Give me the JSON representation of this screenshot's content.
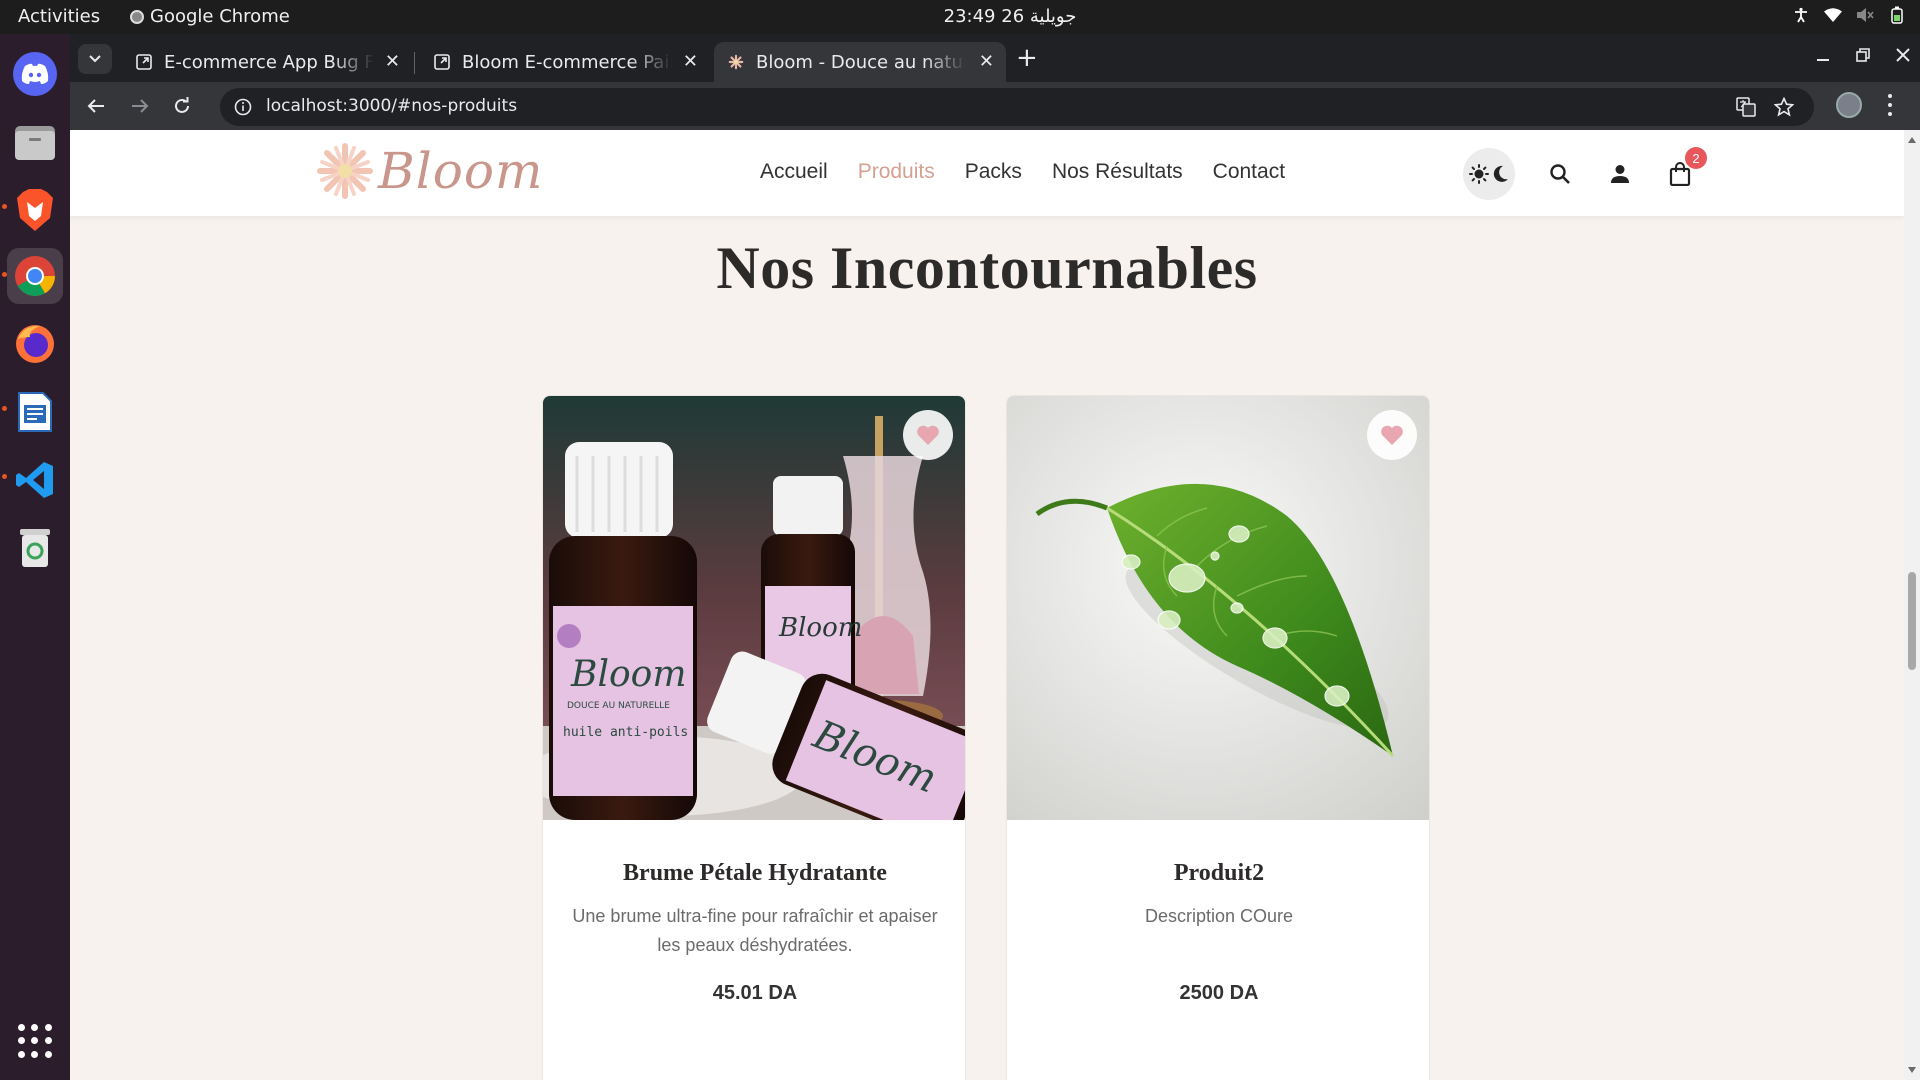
{
  "system": {
    "activities": "Activities",
    "app_name": "Google Chrome",
    "clock": "23:49  26 جويلية"
  },
  "browser": {
    "tabs": [
      {
        "title": "E-commerce App Bug Fix"
      },
      {
        "title": "Bloom E-commerce Pair"
      },
      {
        "title": "Bloom - Douce au naturel"
      }
    ],
    "url": "localhost:3000/#nos-produits"
  },
  "site": {
    "logo_text": "Bloom",
    "nav": [
      "Accueil",
      "Produits",
      "Packs",
      "Nos Résultats",
      "Contact"
    ],
    "active_nav": "Produits",
    "cart_count": "2",
    "brand_color": "#c8968a"
  },
  "section": {
    "title": "Nos Incontournables"
  },
  "products": [
    {
      "name": "Brume Pétale Hydratante",
      "description": "Une brume ultra-fine pour rafraîchir et apaiser les peaux déshydratées.",
      "price": "45.01 DA",
      "image": "bottles-photo"
    },
    {
      "name": "Produit2",
      "description": "Description COure",
      "price": "2500 DA",
      "image": "leaf-photo"
    }
  ]
}
